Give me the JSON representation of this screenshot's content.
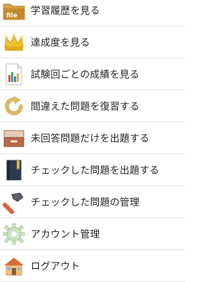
{
  "menu": {
    "items": [
      {
        "label": "学習履歴を見る",
        "icon": "file-folder-icon"
      },
      {
        "label": "達成度を見る",
        "icon": "crown-icon"
      },
      {
        "label": "試験回ごとの成績を見る",
        "icon": "report-chart-icon"
      },
      {
        "label": "間違えた問題を復習する",
        "icon": "refresh-arrow-icon"
      },
      {
        "label": "未回答問題だけを出題する",
        "icon": "drawer-icon"
      },
      {
        "label": "チェックした問題を出題する",
        "icon": "book-icon"
      },
      {
        "label": "チェックした問題の管理",
        "icon": "hammer-icon"
      },
      {
        "label": "アカウント管理",
        "icon": "gear-icon"
      },
      {
        "label": "ログアウト",
        "icon": "house-icon"
      }
    ],
    "file_icon_text": "file"
  }
}
